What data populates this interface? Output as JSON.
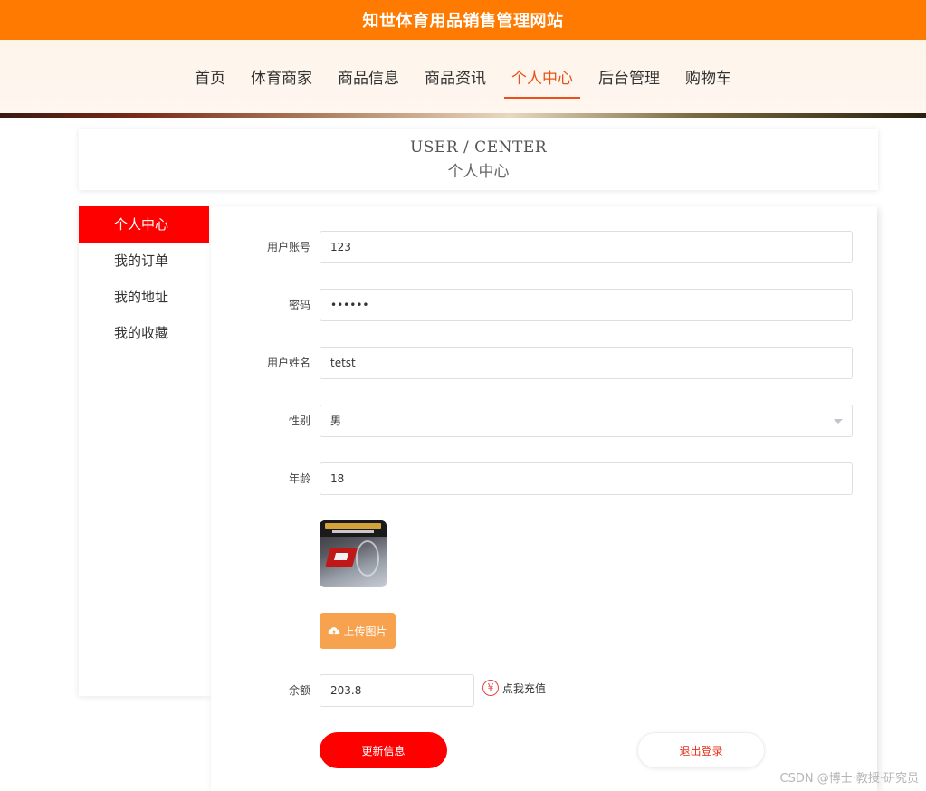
{
  "site": {
    "title": "知世体育用品销售管理网站"
  },
  "nav": {
    "items": [
      {
        "label": "首页",
        "active": false
      },
      {
        "label": "体育商家",
        "active": false
      },
      {
        "label": "商品信息",
        "active": false
      },
      {
        "label": "商品资讯",
        "active": false
      },
      {
        "label": "个人中心",
        "active": true
      },
      {
        "label": "后台管理",
        "active": false
      },
      {
        "label": "购物车",
        "active": false
      }
    ]
  },
  "banner": {
    "en": "USER / CENTER",
    "cn": "个人中心"
  },
  "sidebar": {
    "items": [
      {
        "label": "个人中心",
        "active": true
      },
      {
        "label": "我的订单",
        "active": false
      },
      {
        "label": "我的地址",
        "active": false
      },
      {
        "label": "我的收藏",
        "active": false
      }
    ]
  },
  "form": {
    "account": {
      "label": "用户账号",
      "value": "123"
    },
    "password": {
      "label": "密码",
      "value": "••••••"
    },
    "name": {
      "label": "用户姓名",
      "value": "tetst"
    },
    "gender": {
      "label": "性别",
      "value": "男"
    },
    "age": {
      "label": "年龄",
      "value": "18"
    },
    "avatar_icon": "racket-product-image",
    "upload_label": "上传图片",
    "balance": {
      "label": "余额",
      "value": "203.8"
    },
    "recharge_label": "点我充值"
  },
  "actions": {
    "update_label": "更新信息",
    "logout_label": "退出登录"
  },
  "watermark": "CSDN @博士·教授·研究员",
  "colors": {
    "brand": "#ff7a00",
    "accent": "#ff0000",
    "upload": "#f7a24f"
  }
}
